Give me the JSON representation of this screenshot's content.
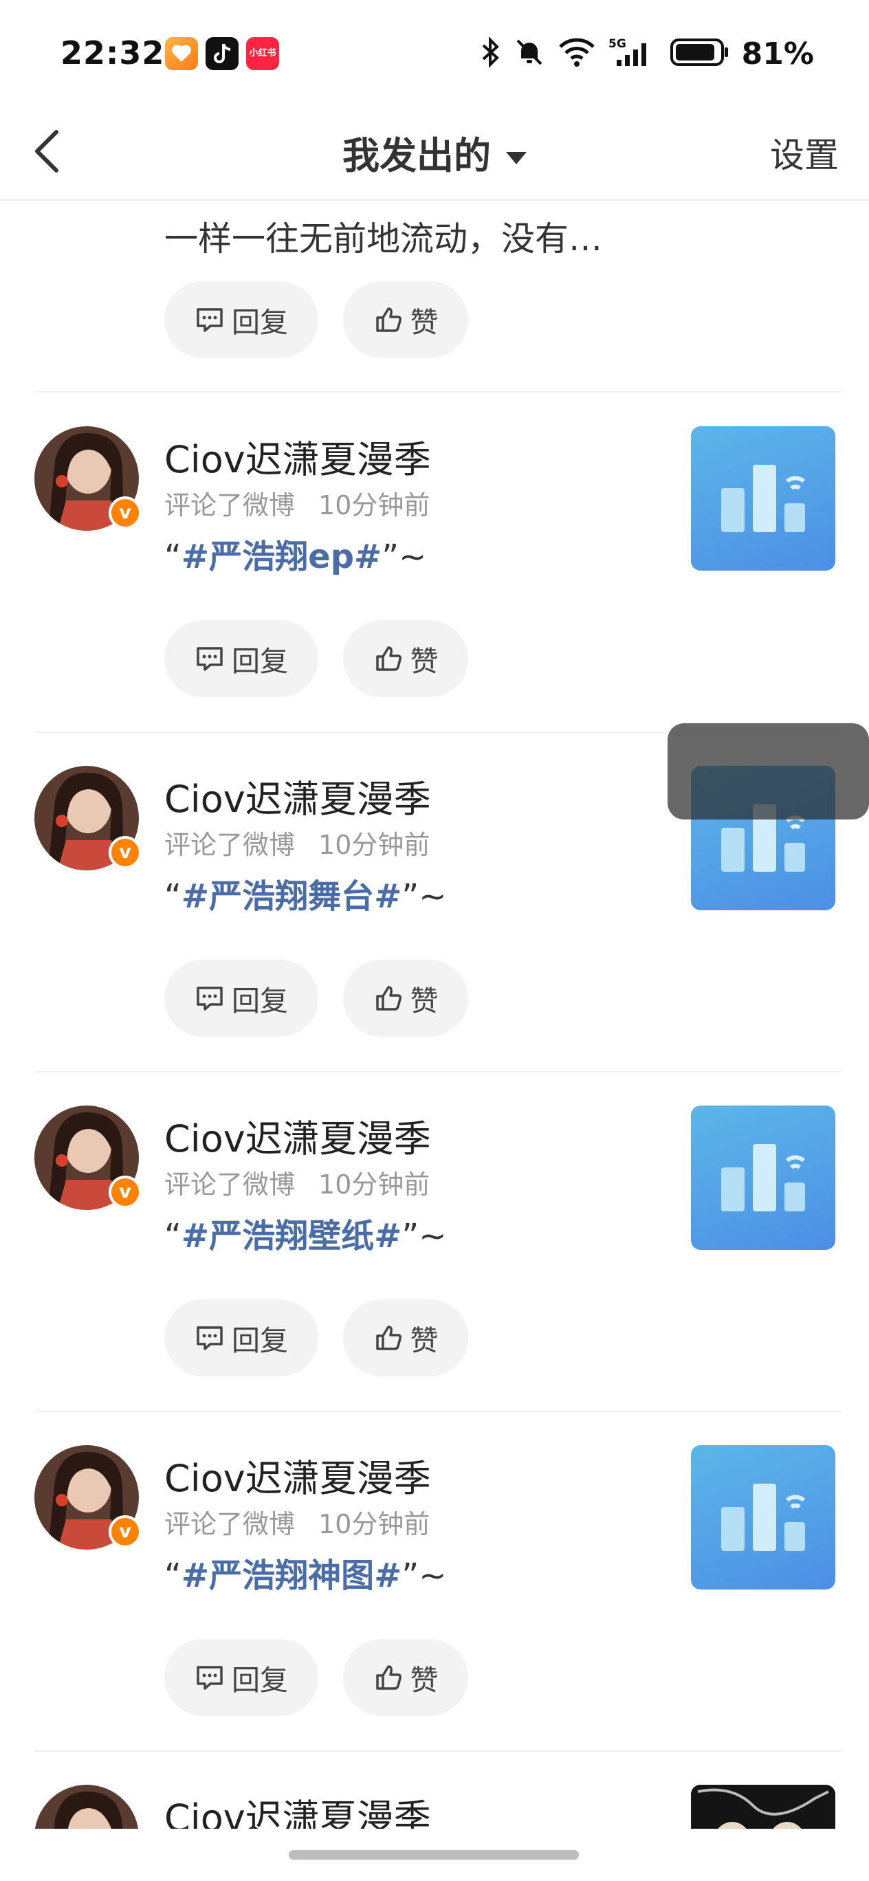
{
  "status_bar": {
    "time": "22:32",
    "red_app_text": "小红书",
    "battery": "81%",
    "network": "5G"
  },
  "nav": {
    "title": "我发出的",
    "settings": "设置"
  },
  "partial_item": {
    "text": "一样一往无前地流动，没有…"
  },
  "actions": {
    "reply": "回复",
    "like": "赞"
  },
  "items": [
    {
      "user": "Ciov迟潇夏漫季",
      "action": "评论了微博",
      "time": "10分钟前",
      "q_open": "“",
      "topic": "#严浩翔ep#",
      "q_close": "”~"
    },
    {
      "user": "Ciov迟潇夏漫季",
      "action": "评论了微博",
      "time": "10分钟前",
      "q_open": "“",
      "topic": "#严浩翔舞台#",
      "q_close": "”~"
    },
    {
      "user": "Ciov迟潇夏漫季",
      "action": "评论了微博",
      "time": "10分钟前",
      "q_open": "“",
      "topic": "#严浩翔壁纸#",
      "q_close": "”~"
    },
    {
      "user": "Ciov迟潇夏漫季",
      "action": "评论了微博",
      "time": "10分钟前",
      "q_open": "“",
      "topic": "#严浩翔神图#",
      "q_close": "”~"
    },
    {
      "user": "Ciov迟潇夏漫季"
    }
  ],
  "colors": {
    "accent_orange": "#ff8200",
    "topic_blue": "#4a6da7",
    "pill_bg": "#f3f3f3"
  }
}
